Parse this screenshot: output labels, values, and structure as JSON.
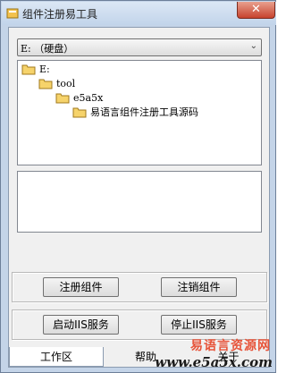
{
  "window": {
    "title": "组件注册易工具",
    "close_label": "✕"
  },
  "drive_select": {
    "value": "E: （硬盘）",
    "arrow": "⌄"
  },
  "tree": {
    "items": [
      {
        "label": "E:"
      },
      {
        "label": "tool"
      },
      {
        "label": "e5a5x"
      },
      {
        "label": "易语言组件注册工具源码"
      }
    ]
  },
  "buttons": {
    "register": "注册组件",
    "unregister": "注销组件",
    "start_iis": "启动IIS服务",
    "stop_iis": "停止IIS服务"
  },
  "tabs": [
    {
      "label": "工作区"
    },
    {
      "label": "帮助"
    },
    {
      "label": "关于"
    }
  ],
  "watermark": {
    "site_name": "易语言资源网",
    "url": "www.e5a5x.com"
  },
  "colors": {
    "folder": "#f6d36b",
    "title_bar": "#c9d9ee",
    "close_button": "#c7432e",
    "watermark_red": "#e7543a"
  }
}
